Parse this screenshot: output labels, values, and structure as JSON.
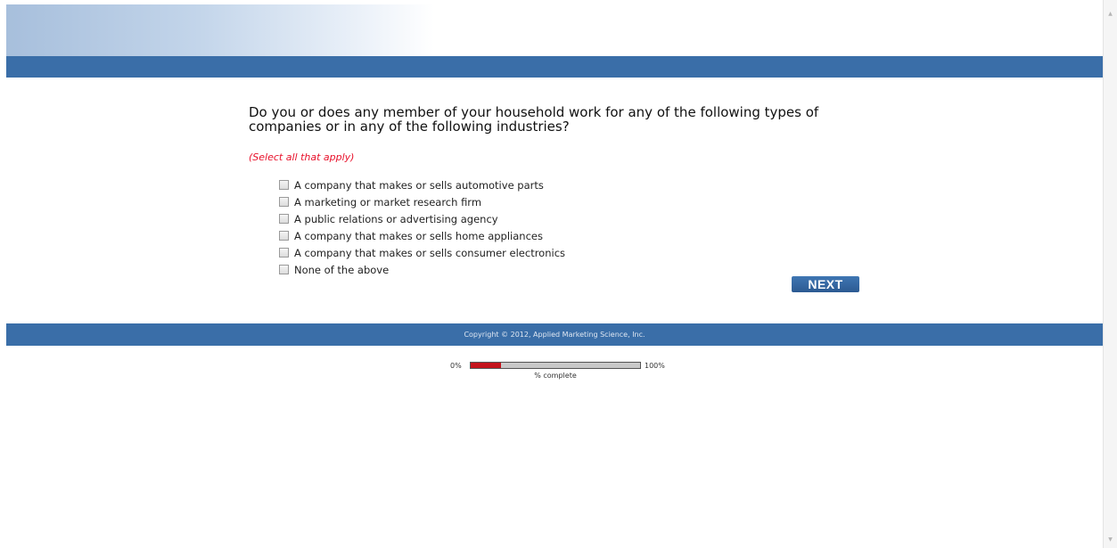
{
  "survey": {
    "question": "Do you or does any member of your household work for any of the following types of companies or in any of the following industries?",
    "instruction": "(Select all that apply)",
    "options": [
      "A company that makes or sells automotive parts",
      "A marketing or market research firm",
      "A public relations or advertising agency",
      "A company that makes or sells home appliances",
      "A company that makes or sells consumer electronics",
      "None of the above"
    ],
    "next_label": "NEXT"
  },
  "footer": {
    "copyright": "Copyright © 2012, Applied Marketing Science, Inc."
  },
  "progress": {
    "min_label": "0%",
    "max_label": "100%",
    "caption": "% complete",
    "value_percent": 18
  },
  "colors": {
    "brand_blue": "#3a6ea8",
    "instruction_red": "#e8102a",
    "progress_red": "#c4131c"
  },
  "icons": {
    "scroll_up": "▲",
    "scroll_down": "▼"
  }
}
